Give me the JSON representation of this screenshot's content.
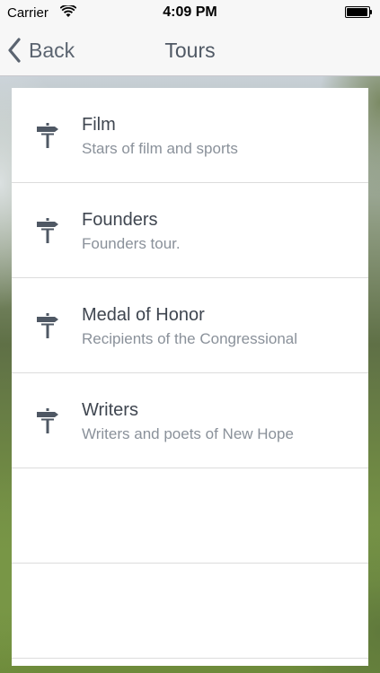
{
  "status_bar": {
    "carrier": "Carrier",
    "time": "4:09 PM",
    "wifi_icon": "wifi-icon",
    "battery_icon": "battery-icon"
  },
  "nav": {
    "back_label": "Back",
    "back_icon": "chevron-left-icon",
    "title": "Tours"
  },
  "colors": {
    "text_primary": "#3f4650",
    "text_secondary": "#8a919a",
    "icon": "#4f5864",
    "nav_background": "#f7f7f7"
  },
  "tours": [
    {
      "title": "Film",
      "subtitle": "Stars of film and sports",
      "icon": "signpost-icon"
    },
    {
      "title": "Founders",
      "subtitle": "Founders tour.",
      "icon": "signpost-icon"
    },
    {
      "title": "Medal of Honor",
      "subtitle": "Recipients of the Congressional",
      "icon": "signpost-icon"
    },
    {
      "title": "Writers",
      "subtitle": "Writers and poets of New Hope",
      "icon": "signpost-icon"
    }
  ]
}
